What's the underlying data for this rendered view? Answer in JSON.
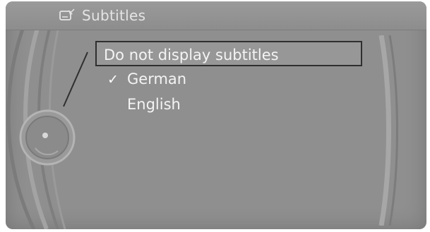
{
  "window": {
    "title": "Subtitles"
  },
  "menu": {
    "items": [
      {
        "label": "Do not display subtitles",
        "checked": false,
        "selected": true
      },
      {
        "label": "German",
        "checked": true,
        "selected": false
      },
      {
        "label": "English",
        "checked": false,
        "selected": false
      }
    ]
  },
  "icons": {
    "title_icon": "subtitles-icon",
    "check_icon": "checkmark-icon",
    "controller_icon": "controller-knob-icon"
  },
  "symbols": {
    "check": "✓"
  },
  "colors": {
    "screen_bg": "#8f8f8f",
    "text": "#f4f4f4",
    "selection_border": "#2f2f2f"
  }
}
